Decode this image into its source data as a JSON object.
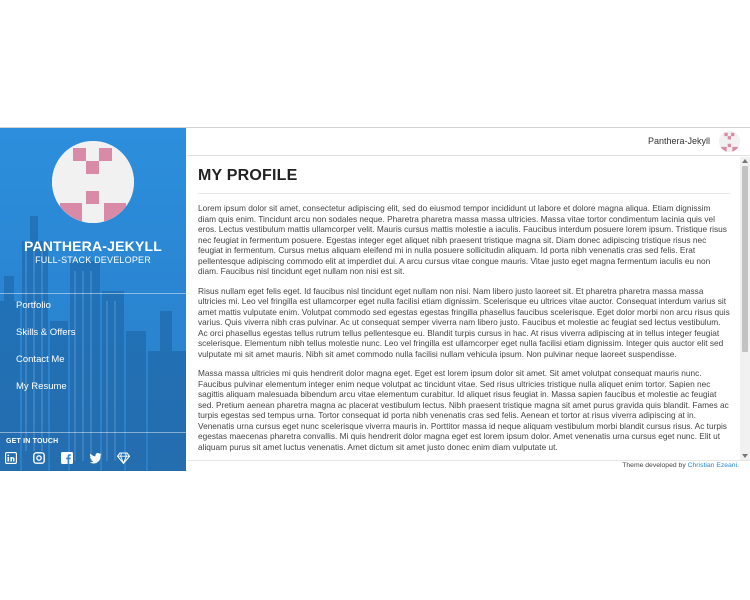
{
  "sidebar": {
    "site_name": "PANTHERA-JEKYLL",
    "site_role": "FULL-STACK DEVELOPER",
    "nav_items": [
      {
        "label": "Portfolio"
      },
      {
        "label": "Skills & Offers"
      },
      {
        "label": "Contact Me"
      },
      {
        "label": "My Resume"
      }
    ],
    "get_in_touch": "GET IN TOUCH",
    "social_icons": [
      "linkedin-icon",
      "instagram-icon",
      "facebook-icon",
      "twitter-icon",
      "diamond-icon"
    ]
  },
  "topbar": {
    "user_name": "Panthera-Jekyll"
  },
  "colors": {
    "sidebar_blue": "#2a86d3",
    "avatar_pink": "#d98aa6",
    "link_blue": "#2a8ad8"
  },
  "main": {
    "title": "MY PROFILE",
    "paragraphs": [
      "Lorem ipsum dolor sit amet, consectetur adipiscing elit, sed do eiusmod tempor incididunt ut labore et dolore magna aliqua. Etiam dignissim diam quis enim. Tincidunt arcu non sodales neque. Pharetra pharetra massa massa ultricies. Massa vitae tortor condimentum lacinia quis vel eros. Lectus vestibulum mattis ullamcorper velit. Mauris cursus mattis molestie a iaculis. Faucibus interdum posuere lorem ipsum. Tristique risus nec feugiat in fermentum posuere. Egestas integer eget aliquet nibh praesent tristique magna sit. Diam donec adipiscing tristique risus nec feugiat in fermentum. Cursus metus aliquam eleifend mi in nulla posuere sollicitudin aliquam. Id porta nibh venenatis cras sed felis. Erat pellentesque adipiscing commodo elit at imperdiet dui. A arcu cursus vitae congue mauris. Vitae justo eget magna fermentum iaculis eu non diam. Faucibus nisl tincidunt eget nullam non nisi est sit.",
      "Risus nullam eget felis eget. Id faucibus nisl tincidunt eget nullam non nisi. Nam libero justo laoreet sit. Et pharetra pharetra massa massa ultricies mi. Leo vel fringilla est ullamcorper eget nulla facilisi etiam dignissim. Scelerisque eu ultrices vitae auctor. Consequat interdum varius sit amet mattis vulputate enim. Volutpat commodo sed egestas egestas fringilla phasellus faucibus scelerisque. Eget dolor morbi non arcu risus quis varius. Quis viverra nibh cras pulvinar. Ac ut consequat semper viverra nam libero justo. Faucibus et molestie ac feugiat sed lectus vestibulum. Ac orci phasellus egestas tellus rutrum tellus pellentesque eu. Blandit turpis cursus in hac. At risus viverra adipiscing at in tellus integer feugiat scelerisque. Elementum nibh tellus molestie nunc. Leo vel fringilla est ullamcorper eget nulla facilisi etiam dignissim. Integer quis auctor elit sed vulputate mi sit amet mauris. Nibh sit amet commodo nulla facilisi nullam vehicula ipsum. Non pulvinar neque laoreet suspendisse.",
      "Massa massa ultricies mi quis hendrerit dolor magna eget. Eget est lorem ipsum dolor sit amet. Sit amet volutpat consequat mauris nunc. Faucibus pulvinar elementum integer enim neque volutpat ac tincidunt vitae. Sed risus ultricies tristique nulla aliquet enim tortor. Sapien nec sagittis aliquam malesuada bibendum arcu vitae elementum curabitur. Id aliquet risus feugiat in. Massa sapien faucibus et molestie ac feugiat sed. Pretium aenean pharetra magna ac placerat vestibulum lectus. Nibh praesent tristique magna sit amet purus gravida quis blandit. Fames ac turpis egestas sed tempus urna. Tortor consequat id porta nibh venenatis cras sed felis. Aenean et tortor at risus viverra adipiscing at in. Venenatis urna cursus eget nunc scelerisque viverra mauris in. Porttitor massa id neque aliquam vestibulum morbi blandit cursus risus. Ac turpis egestas maecenas pharetra convallis. Mi quis hendrerit dolor magna eget est lorem ipsum dolor. Amet venenatis urna cursus eget nunc. Elit ut aliquam purus sit amet luctus venenatis. Amet dictum sit amet justo donec enim diam vulputate ut."
    ]
  },
  "footer": {
    "text": "Theme developed by",
    "link": "Christian Ezeani."
  }
}
